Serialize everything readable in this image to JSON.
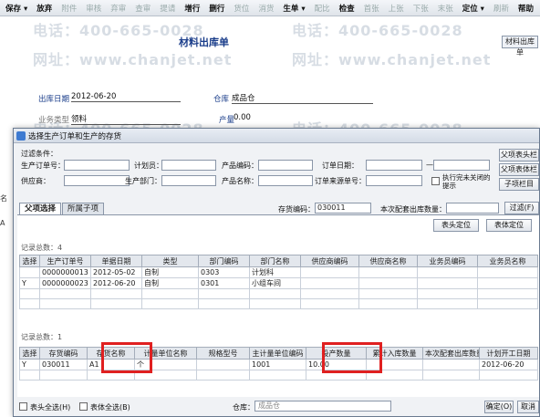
{
  "toolbar": {
    "items": [
      {
        "label": "保存 ▾",
        "active": true
      },
      {
        "label": "放弃",
        "active": true
      },
      {
        "label": "附件",
        "active": false
      },
      {
        "label": "审核",
        "active": false
      },
      {
        "label": "弃审",
        "active": false
      },
      {
        "label": "查审",
        "active": false
      },
      {
        "label": "提请",
        "active": false
      },
      {
        "label": "增行",
        "active": true
      },
      {
        "label": "删行",
        "active": true
      },
      {
        "label": "货位",
        "active": false
      },
      {
        "label": "消货",
        "active": false
      },
      {
        "label": "生单 ▾",
        "active": true
      },
      {
        "label": "配比",
        "active": false
      },
      {
        "label": "检查",
        "active": true
      },
      {
        "label": "首张",
        "active": false
      },
      {
        "label": "上张",
        "active": false
      },
      {
        "label": "下张",
        "active": false
      },
      {
        "label": "末张",
        "active": false
      },
      {
        "label": "定位 ▾",
        "active": true
      },
      {
        "label": "刷新",
        "active": false
      },
      {
        "label": "帮助",
        "active": true
      },
      {
        "label": "退出",
        "active": false
      }
    ]
  },
  "document": {
    "title": "材料出库单",
    "corner_button": "材料出库单",
    "date_label": "出库日期",
    "date_value": "2012-06-20",
    "warehouse_label": "仓库",
    "warehouse_value": "成品仓",
    "biz_type_label": "业务类型",
    "biz_type_value": "领料",
    "quantity_label": "产量",
    "quantity_value": "0.00",
    "left_fragment": "名",
    "left_fragment2": "A"
  },
  "watermark": {
    "phone": "电话：400-665-0028",
    "site": "网址：www.chanjet.net"
  },
  "dialog": {
    "title": "选择生产订单和生产的存货",
    "filter_heading": "过滤条件：",
    "filters": {
      "order_no": "生产订单号：",
      "planner": "计划员：",
      "product_code": "产品编码：",
      "order_date": "订单日期：",
      "supplier": "供应商：",
      "dept": "生产部门：",
      "product_name": "产品名称：",
      "source_no": "订单来源单号：",
      "exec_done": "执行完未关闭的提示"
    },
    "right_buttons": [
      "父项表头栏",
      "父项表体栏",
      "子项栏目"
    ],
    "tabs": [
      "父项选择",
      "所属子项"
    ],
    "inventory_code_label": "存货编码：",
    "inventory_code_value": "030011",
    "match_qty_label": "本次配套出库数量：",
    "filter_button": "过滤(F)",
    "locate_head_button": "表头定位",
    "locate_body_button": "表体定位",
    "upper_record_count": "记录总数：4",
    "lower_record_count": "记录总数：1",
    "select_all_head": "表头全选(H)",
    "select_all_body": "表体全选(B)",
    "warehouse_label": "仓库：",
    "warehouse_value": "成品仓",
    "ok_button": "确定(O)",
    "cancel_button": "取消"
  },
  "upper_table": {
    "columns": [
      "选择",
      "生产订单号",
      "单据日期",
      "类型",
      "部门编码",
      "部门名称",
      "供应商编码",
      "供应商名称",
      "业务员编码",
      "业务员名称"
    ],
    "rows": [
      [
        "",
        "0000000013",
        "2012-05-02",
        "自制",
        "0303",
        "计划科",
        "",
        "",
        "",
        ""
      ],
      [
        "Y",
        "0000000023",
        "2012-06-20",
        "自制",
        "0301",
        "小组车间",
        "",
        "",
        "",
        ""
      ]
    ]
  },
  "lower_table": {
    "columns": [
      "选择",
      "存货编码",
      "存货名称",
      "计量单位名称",
      "规格型号",
      "主计量单位编码",
      "投产数量",
      "累计入库数量",
      "本次配套出库数量",
      "计划开工日期"
    ],
    "rows": [
      [
        "Y",
        "030011",
        "A1",
        "个",
        "",
        "1001",
        "10.00",
        "",
        "",
        "2012-06-20"
      ]
    ]
  }
}
